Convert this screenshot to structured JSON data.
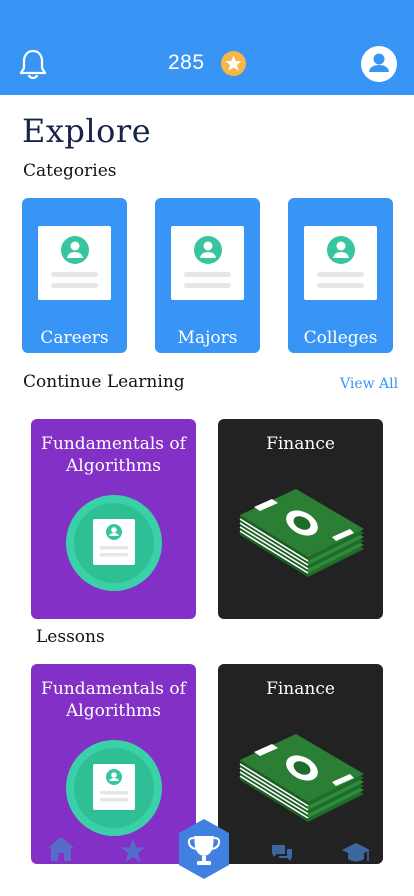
{
  "header": {
    "score": "285",
    "icons": [
      "bell-icon",
      "star-coin-icon",
      "user-avatar-icon"
    ],
    "accent": "#3895f5",
    "coin_color": "#f5b847"
  },
  "page": {
    "title": "Explore"
  },
  "categories": {
    "label": "Categories",
    "items": [
      {
        "label": "Careers"
      },
      {
        "label": "Majors"
      },
      {
        "label": "Colleges"
      }
    ]
  },
  "continue_learning": {
    "label": "Continue Learning",
    "view_all": "View All",
    "cards": [
      {
        "title": "Fundamentals of Algorithms",
        "color": "#8330c6",
        "icon": "profile-badge-icon"
      },
      {
        "title": "Finance",
        "color": "#222222",
        "icon": "money-stack-icon"
      }
    ]
  },
  "lessons": {
    "label": "Lessons",
    "cards": [
      {
        "title": "Fundamentals of Algorithms",
        "color": "#8330c6",
        "icon": "profile-badge-icon"
      },
      {
        "title": "Finance",
        "color": "#222222",
        "icon": "money-stack-icon"
      }
    ]
  },
  "bottom_nav": {
    "items": [
      {
        "icon": "home-icon"
      },
      {
        "icon": "star-icon"
      },
      {
        "icon": "trophy-icon",
        "active": true
      },
      {
        "icon": "chat-icon"
      },
      {
        "icon": "graduation-cap-icon"
      }
    ]
  }
}
